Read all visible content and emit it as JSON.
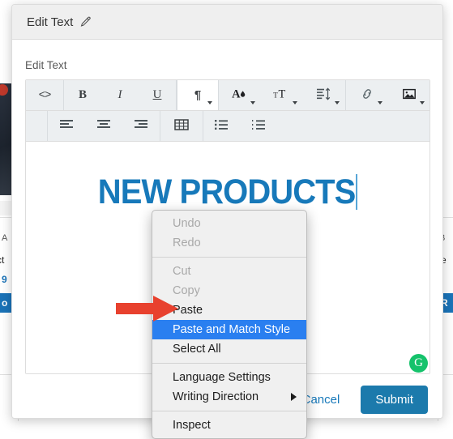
{
  "background": {
    "left_card": {
      "label": "A",
      "title_fragment": "ct",
      "price_fragment": "9",
      "button_fragment": "o"
    },
    "right_card": {
      "label": "B",
      "title_fragment": "re",
      "button_fragment": "R"
    }
  },
  "modal": {
    "header": {
      "title": "Edit Text",
      "edit_icon": "pencil-icon"
    },
    "field_label": "Edit Text",
    "toolbar": {
      "row1": [
        {
          "name": "source-code",
          "glyph": "<>",
          "type": "code",
          "active": false,
          "caret": false
        },
        {
          "name": "bold",
          "glyph": "B",
          "type": "bold",
          "active": false,
          "caret": false
        },
        {
          "name": "italic",
          "glyph": "I",
          "type": "italic",
          "active": false,
          "caret": false
        },
        {
          "name": "underline",
          "glyph": "U",
          "type": "underline",
          "active": false,
          "caret": false
        },
        {
          "name": "paragraph-format",
          "glyph": "¶",
          "type": "pilcrow",
          "active": true,
          "caret": true
        },
        {
          "name": "text-color",
          "glyph": "",
          "type": "text-color",
          "active": false,
          "caret": true
        },
        {
          "name": "font-size",
          "glyph": "",
          "type": "font-size",
          "active": false,
          "caret": true
        },
        {
          "name": "line-height",
          "glyph": "",
          "type": "line-height",
          "active": false,
          "caret": true
        },
        {
          "name": "insert-link",
          "glyph": "",
          "type": "link",
          "active": false,
          "caret": true
        },
        {
          "name": "insert-image",
          "glyph": "",
          "type": "image",
          "active": false,
          "caret": true
        }
      ],
      "row2": [
        {
          "name": "align-left",
          "type": "align-left"
        },
        {
          "name": "align-center",
          "type": "align-center"
        },
        {
          "name": "align-right",
          "type": "align-right"
        },
        {
          "name": "insert-table",
          "type": "table"
        },
        {
          "name": "unordered-list",
          "type": "ul"
        },
        {
          "name": "ordered-list",
          "type": "ol"
        }
      ]
    },
    "editor": {
      "headline": "NEW PRODUCTS",
      "headline_color": "#1779ba",
      "caret_visible": true
    },
    "grammarly": {
      "name": "grammarly-icon",
      "letter": "G",
      "color": "#15c26b"
    },
    "footer": {
      "cancel_label": "Cancel",
      "submit_label": "Submit",
      "submit_color": "#1c7aac",
      "cancel_color": "#1779ba"
    }
  },
  "context_menu": {
    "highlight_color": "#2a7ff0",
    "groups": [
      [
        {
          "label": "Undo",
          "state": "disabled",
          "submenu": false
        },
        {
          "label": "Redo",
          "state": "disabled",
          "submenu": false
        }
      ],
      [
        {
          "label": "Cut",
          "state": "disabled",
          "submenu": false
        },
        {
          "label": "Copy",
          "state": "disabled",
          "submenu": false
        },
        {
          "label": "Paste",
          "state": "normal",
          "submenu": false
        },
        {
          "label": "Paste and Match Style",
          "state": "selected",
          "submenu": false
        },
        {
          "label": "Select All",
          "state": "normal",
          "submenu": false
        }
      ],
      [
        {
          "label": "Language Settings",
          "state": "normal",
          "submenu": false
        },
        {
          "label": "Writing Direction",
          "state": "normal",
          "submenu": true
        }
      ],
      [
        {
          "label": "Inspect",
          "state": "normal",
          "submenu": false
        }
      ]
    ]
  },
  "annotation": {
    "arrow_color": "#e8412e",
    "points_to": "Paste and Match Style"
  }
}
